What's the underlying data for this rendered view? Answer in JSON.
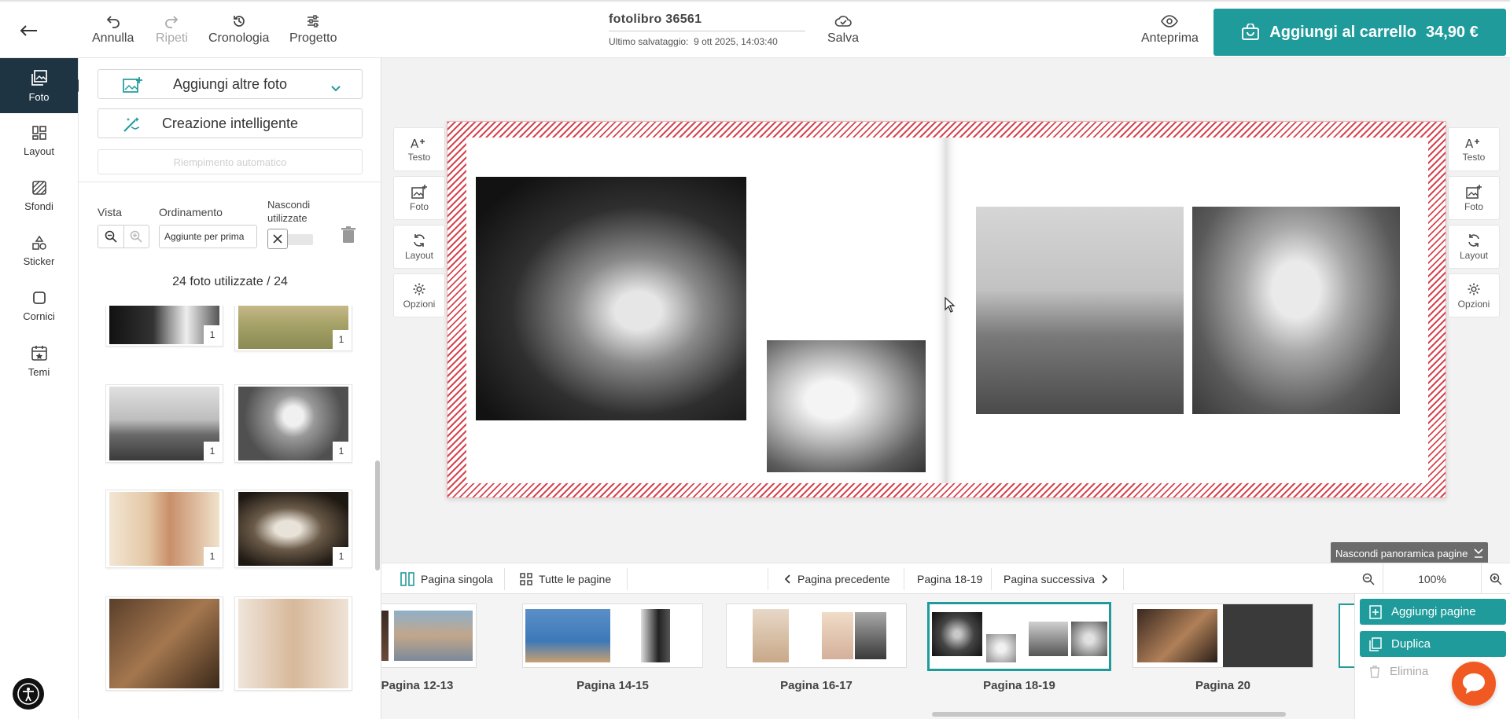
{
  "colors": {
    "accent": "#1f9b9b",
    "rail_active": "#1f3442",
    "spread_border": "#d64550",
    "chat": "#f05a22"
  },
  "header": {
    "undo_label": "Annulla",
    "redo_label": "Ripeti",
    "history_label": "Cronologia",
    "project_label": "Progetto",
    "doc_title": "fotolibro 36561",
    "saved_label": "Ultimo salvataggio:",
    "saved_time": "9 ott 2025, 14:03:40",
    "save_label": "Salva",
    "preview_label": "Anteprima",
    "cart_label": "Aggiungi al carrello",
    "cart_price": "34,90 €"
  },
  "rail": {
    "items": [
      {
        "label": "Foto",
        "icon": "photo-icon"
      },
      {
        "label": "Layout",
        "icon": "layout-icon"
      },
      {
        "label": "Sfondi",
        "icon": "background-icon"
      },
      {
        "label": "Sticker",
        "icon": "sticker-icon"
      },
      {
        "label": "Cornici",
        "icon": "frame-icon"
      },
      {
        "label": "Temi",
        "icon": "theme-icon"
      }
    ]
  },
  "panel": {
    "add_photos": "Aggiungi altre foto",
    "smart_create": "Creazione intelligente",
    "auto_fill": "Riempimento automatico",
    "view_label": "Vista",
    "sort_label": "Ordinamento",
    "sort_value": "Aggiunte per prima",
    "hide_used_line1": "Nascondi",
    "hide_used_line2": "utilizzate",
    "used_count": "24 foto utilizzate / 24",
    "thumb_badges": [
      "1",
      "1",
      "1",
      "1",
      "1",
      "1",
      "",
      ""
    ]
  },
  "side_tools": {
    "text": "Testo",
    "photo": "Foto",
    "layout": "Layout",
    "options": "Opzioni"
  },
  "nav": {
    "single_page": "Pagina singola",
    "all_pages": "Tutte le pagine",
    "prev_page": "Pagina precedente",
    "current": "Pagina 18-19",
    "next_page": "Pagina successiva",
    "hide_overview": "Nascondi panoramica pagine",
    "zoom": "100%"
  },
  "pages": [
    {
      "label": "Pagina 12-13"
    },
    {
      "label": "Pagina 14-15"
    },
    {
      "label": "Pagina 16-17"
    },
    {
      "label": "Pagina 18-19"
    },
    {
      "label": "Pagina 20"
    }
  ],
  "actions": {
    "add_pages": "Aggiungi pagine",
    "duplicate": "Duplica",
    "delete": "Elimina"
  }
}
